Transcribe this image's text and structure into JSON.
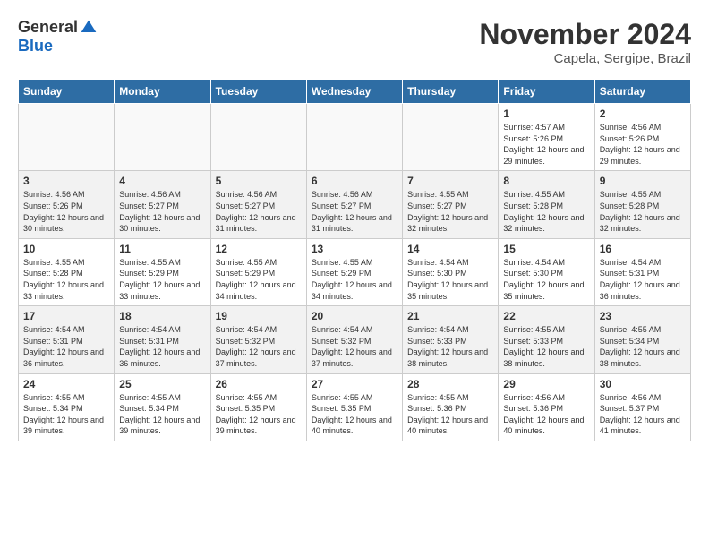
{
  "header": {
    "logo_general": "General",
    "logo_blue": "Blue",
    "month_title": "November 2024",
    "location": "Capela, Sergipe, Brazil"
  },
  "calendar": {
    "days_of_week": [
      "Sunday",
      "Monday",
      "Tuesday",
      "Wednesday",
      "Thursday",
      "Friday",
      "Saturday"
    ],
    "weeks": [
      [
        {
          "day": "",
          "info": ""
        },
        {
          "day": "",
          "info": ""
        },
        {
          "day": "",
          "info": ""
        },
        {
          "day": "",
          "info": ""
        },
        {
          "day": "",
          "info": ""
        },
        {
          "day": "1",
          "info": "Sunrise: 4:57 AM\nSunset: 5:26 PM\nDaylight: 12 hours and 29 minutes."
        },
        {
          "day": "2",
          "info": "Sunrise: 4:56 AM\nSunset: 5:26 PM\nDaylight: 12 hours and 29 minutes."
        }
      ],
      [
        {
          "day": "3",
          "info": "Sunrise: 4:56 AM\nSunset: 5:26 PM\nDaylight: 12 hours and 30 minutes."
        },
        {
          "day": "4",
          "info": "Sunrise: 4:56 AM\nSunset: 5:27 PM\nDaylight: 12 hours and 30 minutes."
        },
        {
          "day": "5",
          "info": "Sunrise: 4:56 AM\nSunset: 5:27 PM\nDaylight: 12 hours and 31 minutes."
        },
        {
          "day": "6",
          "info": "Sunrise: 4:56 AM\nSunset: 5:27 PM\nDaylight: 12 hours and 31 minutes."
        },
        {
          "day": "7",
          "info": "Sunrise: 4:55 AM\nSunset: 5:27 PM\nDaylight: 12 hours and 32 minutes."
        },
        {
          "day": "8",
          "info": "Sunrise: 4:55 AM\nSunset: 5:28 PM\nDaylight: 12 hours and 32 minutes."
        },
        {
          "day": "9",
          "info": "Sunrise: 4:55 AM\nSunset: 5:28 PM\nDaylight: 12 hours and 32 minutes."
        }
      ],
      [
        {
          "day": "10",
          "info": "Sunrise: 4:55 AM\nSunset: 5:28 PM\nDaylight: 12 hours and 33 minutes."
        },
        {
          "day": "11",
          "info": "Sunrise: 4:55 AM\nSunset: 5:29 PM\nDaylight: 12 hours and 33 minutes."
        },
        {
          "day": "12",
          "info": "Sunrise: 4:55 AM\nSunset: 5:29 PM\nDaylight: 12 hours and 34 minutes."
        },
        {
          "day": "13",
          "info": "Sunrise: 4:55 AM\nSunset: 5:29 PM\nDaylight: 12 hours and 34 minutes."
        },
        {
          "day": "14",
          "info": "Sunrise: 4:54 AM\nSunset: 5:30 PM\nDaylight: 12 hours and 35 minutes."
        },
        {
          "day": "15",
          "info": "Sunrise: 4:54 AM\nSunset: 5:30 PM\nDaylight: 12 hours and 35 minutes."
        },
        {
          "day": "16",
          "info": "Sunrise: 4:54 AM\nSunset: 5:31 PM\nDaylight: 12 hours and 36 minutes."
        }
      ],
      [
        {
          "day": "17",
          "info": "Sunrise: 4:54 AM\nSunset: 5:31 PM\nDaylight: 12 hours and 36 minutes."
        },
        {
          "day": "18",
          "info": "Sunrise: 4:54 AM\nSunset: 5:31 PM\nDaylight: 12 hours and 36 minutes."
        },
        {
          "day": "19",
          "info": "Sunrise: 4:54 AM\nSunset: 5:32 PM\nDaylight: 12 hours and 37 minutes."
        },
        {
          "day": "20",
          "info": "Sunrise: 4:54 AM\nSunset: 5:32 PM\nDaylight: 12 hours and 37 minutes."
        },
        {
          "day": "21",
          "info": "Sunrise: 4:54 AM\nSunset: 5:33 PM\nDaylight: 12 hours and 38 minutes."
        },
        {
          "day": "22",
          "info": "Sunrise: 4:55 AM\nSunset: 5:33 PM\nDaylight: 12 hours and 38 minutes."
        },
        {
          "day": "23",
          "info": "Sunrise: 4:55 AM\nSunset: 5:34 PM\nDaylight: 12 hours and 38 minutes."
        }
      ],
      [
        {
          "day": "24",
          "info": "Sunrise: 4:55 AM\nSunset: 5:34 PM\nDaylight: 12 hours and 39 minutes."
        },
        {
          "day": "25",
          "info": "Sunrise: 4:55 AM\nSunset: 5:34 PM\nDaylight: 12 hours and 39 minutes."
        },
        {
          "day": "26",
          "info": "Sunrise: 4:55 AM\nSunset: 5:35 PM\nDaylight: 12 hours and 39 minutes."
        },
        {
          "day": "27",
          "info": "Sunrise: 4:55 AM\nSunset: 5:35 PM\nDaylight: 12 hours and 40 minutes."
        },
        {
          "day": "28",
          "info": "Sunrise: 4:55 AM\nSunset: 5:36 PM\nDaylight: 12 hours and 40 minutes."
        },
        {
          "day": "29",
          "info": "Sunrise: 4:56 AM\nSunset: 5:36 PM\nDaylight: 12 hours and 40 minutes."
        },
        {
          "day": "30",
          "info": "Sunrise: 4:56 AM\nSunset: 5:37 PM\nDaylight: 12 hours and 41 minutes."
        }
      ]
    ]
  }
}
